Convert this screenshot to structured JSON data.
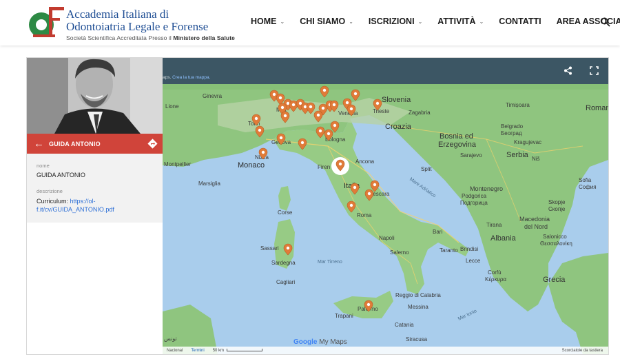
{
  "header": {
    "brand_line1": "Accademia Italiana di",
    "brand_line2": "Odontoiatria Legale e Forense",
    "brand_line3a": "Società Scientifica Accreditata Presso il",
    "brand_line3b": "Ministero della Salute",
    "logo_letters": "OLF",
    "nav": [
      {
        "label": "HOME",
        "dropdown": true
      },
      {
        "label": "CHI SIAMO",
        "dropdown": true
      },
      {
        "label": "ISCRIZIONI",
        "dropdown": true
      },
      {
        "label": "ATTIVITÀ",
        "dropdown": true
      },
      {
        "label": "CONTATTI",
        "dropdown": false
      },
      {
        "label": "AREA ASSOCIATI",
        "dropdown": true
      }
    ],
    "search_icon": "search-icon"
  },
  "panel": {
    "title": "GUIDA ANTONIO",
    "back_icon": "arrow-left-icon",
    "directions_icon": "directions-icon",
    "name_label": "nome",
    "name_value": "GUIDA ANTONIO",
    "desc_label": "descrizione",
    "cv_prefix": "Curriculum:",
    "cv_link_1": "https://ol-",
    "cv_link_2": "f.it/cv/GUIDA_ANTONIO.pdf"
  },
  "map": {
    "topbar_text": "aps.",
    "topbar_link": "Crea la tua mappa.",
    "places": {
      "slovenia": "Slovenia",
      "croazia": "Croazia",
      "bosnia1": "Bosnia ed",
      "bosnia2": "Erzegovina",
      "serbia": "Serbia",
      "montenegro": "Montenegro",
      "albania": "Albania",
      "grecia": "Grecia",
      "italia": "Italia",
      "monaco": "Monaco",
      "roma": "Roma",
      "napoli": "Napoli",
      "firenze": "Firen",
      "bologna": "Bologna",
      "genova": "Genova",
      "venezia": "Venezia",
      "milano": "Mila",
      "torino": "Torin",
      "trieste": "Trieste",
      "zagabria": "Zagabria",
      "ginevra": "Ginevra",
      "lione": "Lione",
      "belgrado1": "Belgrado",
      "belgrado2": "Београд",
      "sarajevo": "Sarajevo",
      "sofia1": "Sofia",
      "sofia2": "София",
      "skopje1": "Skopje",
      "skopje2": "Скопје",
      "macedonia1": "Macedonia",
      "macedonia2": "del Nord",
      "salonicco1": "Salonicco",
      "salonicco2": "Θεσσαλονίκη",
      "podgorica1": "Podgorica",
      "podgorica2": "Подгорица",
      "tirana": "Tirana",
      "bari": "Bari",
      "taranto": "Taranto",
      "brindisi": "Brindisi",
      "lecce": "Lecce",
      "palermo": "Palermo",
      "catania": "Catania",
      "messina": "Messina",
      "reggio": "Reggio di Calabria",
      "cagliari": "Cagliari",
      "sardegna": "Sardegna",
      "sassari": "Sassari",
      "corse": "Corse",
      "marsiglia": "Marsiglia",
      "montpellier": "Montpellier",
      "nizza": "Nizza",
      "pescara": "Pescara",
      "salerno": "Salerno",
      "ancona": "Ancona",
      "split": "Split",
      "timisoara": "Timișoara",
      "nis": "Niš",
      "kragujevac": "Kragujevac",
      "roman": "Roman",
      "corfu1": "Corfù",
      "corfu2": "Κέρκυρα",
      "trapani": "Trapani",
      "siracusa": "Siracusa",
      "mar_tirreno": "Mar Tirreno",
      "mare_adriatico": "Mare Adriatico",
      "mar_ionio": "Mar Ionio",
      "tunisi": "تونس"
    },
    "google": "Google",
    "google_maps": "My Maps",
    "attrib_left": "Nacional",
    "attrib_terms": "Termini",
    "attrib_scale": "50 km",
    "attrib_keys": "Scorciatoie da tastiera",
    "share_icon": "share-icon",
    "fullscreen_icon": "fullscreen-icon",
    "pin_color": "#e07b39",
    "water_color": "#a9cdec",
    "land_color": "#8fc57f"
  }
}
